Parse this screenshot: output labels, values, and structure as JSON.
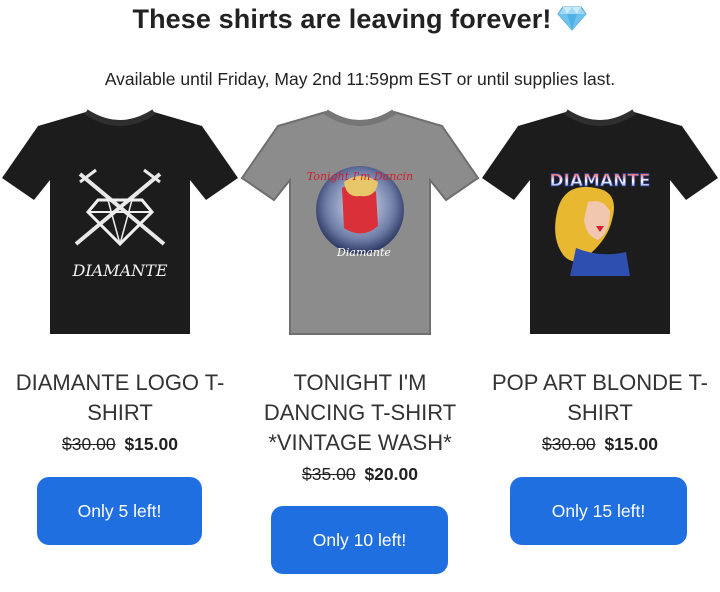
{
  "header": {
    "title": "These shirts are leaving forever!",
    "subtitle": "Available until Friday, May 2nd 11:59pm EST or until supplies last."
  },
  "products": [
    {
      "name": "DIAMANTE LOGO T-SHIRT",
      "old_price": "$30.00",
      "new_price": "$15.00",
      "button_label": "Only 5 left!",
      "shirt_text": "DIAMANTE",
      "shirt_color": "#1e1e1e"
    },
    {
      "name": "TONIGHT I'M DANCING T-SHIRT *VINTAGE WASH*",
      "old_price": "$35.00",
      "new_price": "$20.00",
      "button_label": "Only 10 left!",
      "shirt_text_top": "Tonight I'm Dancin",
      "shirt_text_bottom": "Diamante",
      "shirt_color": "#8a8a8a"
    },
    {
      "name": "POP ART BLONDE T-SHIRT",
      "old_price": "$30.00",
      "new_price": "$15.00",
      "button_label": "Only 15 left!",
      "shirt_text": "DIAMANTE",
      "shirt_color": "#1e1e1e"
    }
  ],
  "colors": {
    "button": "#1f6fe0",
    "button_text": "#ffffff",
    "text": "#222222"
  },
  "icons": {
    "title_emoji": "gem-icon"
  }
}
